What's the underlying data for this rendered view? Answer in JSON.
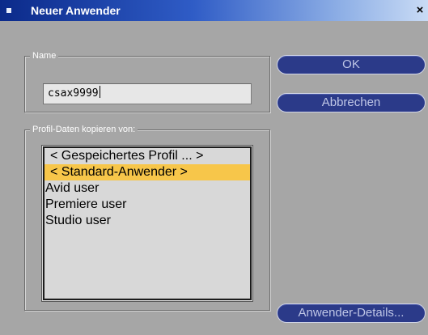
{
  "window": {
    "title": "Neuer Anwender",
    "close_glyph": "×"
  },
  "name_group": {
    "legend": "Name",
    "input_value": "csax9999"
  },
  "profile_group": {
    "legend": "Profil-Daten kopieren von:",
    "items": [
      {
        "label": "< Gespeichertes Profil ... >",
        "selected": false
      },
      {
        "label": "< Standard-Anwender >",
        "selected": true
      },
      {
        "label": "Avid user",
        "selected": false
      },
      {
        "label": "Premiere user",
        "selected": false
      },
      {
        "label": "Studio user",
        "selected": false
      }
    ]
  },
  "buttons": {
    "ok": "OK",
    "cancel": "Abbrechen",
    "details": "Anwender-Details..."
  },
  "colors": {
    "title_start": "#0b2a8a",
    "title_end": "#c9dbf5",
    "dialog_bg": "#a6a6a6",
    "button_bg": "#2b3a89",
    "selection": "#f7c64a"
  },
  "icons": {
    "title": "window-menu-icon",
    "close": "close-icon"
  }
}
